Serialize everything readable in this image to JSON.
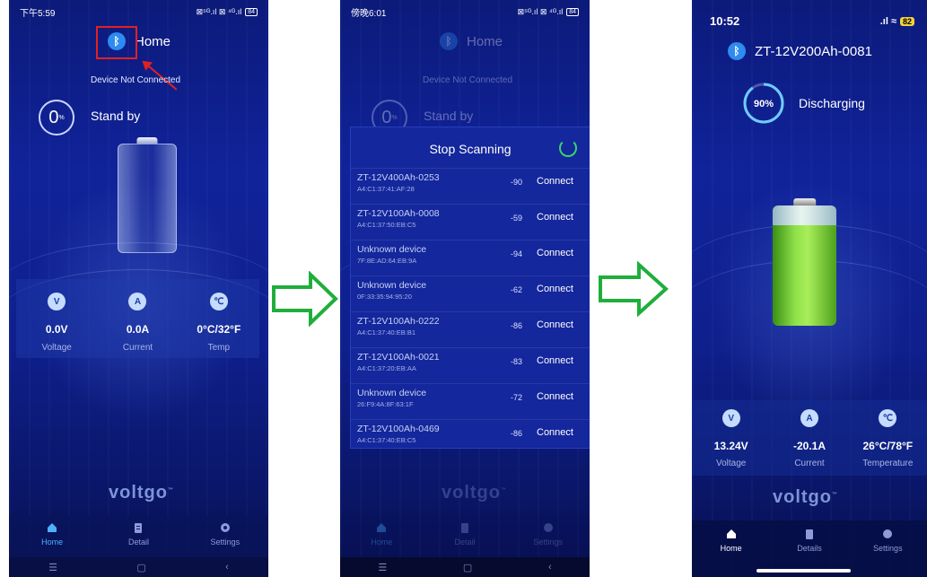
{
  "panel1": {
    "status_time": "下午5:59",
    "status_icons": "⊠⁵ᴳ.ıl ⊠ ⁴ᴳ.ıl",
    "battery_indicator": "84",
    "bluetooth_icon": "bluetooth-icon",
    "title": "Home",
    "connection_status": "Device Not Connected",
    "percent": "0",
    "percent_sign": "%",
    "state": "Stand by",
    "stats": [
      {
        "icon": "voltage-icon",
        "glyph": "V",
        "value": "0.0V",
        "label": "Voltage"
      },
      {
        "icon": "current-icon",
        "glyph": "A",
        "value": "0.0A",
        "label": "Current"
      },
      {
        "icon": "thermometer-icon",
        "glyph": "℃",
        "value": "0°C/32°F",
        "label": "Temp"
      }
    ],
    "logo": "voltgo",
    "logo_tm": "™",
    "tabs": [
      {
        "label": "Home",
        "icon": "home-icon",
        "active": true
      },
      {
        "label": "Detail",
        "icon": "clipboard-icon",
        "active": false
      },
      {
        "label": "Settings",
        "icon": "gear-icon",
        "active": false
      }
    ],
    "nav": [
      "☰",
      "▢",
      "‹"
    ]
  },
  "panel2": {
    "status_time": "傍晚6:01",
    "status_icons": "⊠⁵ᴳ.ıl ⊠ ⁴ᴳ.ıl",
    "battery_indicator": "84",
    "title": "Home",
    "connection_status": "Device Not Connected",
    "percent": "0",
    "percent_sign": "%",
    "state": "Stand by",
    "logo": "voltgo",
    "logo_tm": "™",
    "dialog": {
      "title": "Stop Scanning",
      "devices": [
        {
          "name": "ZT-12V400Ah-0253",
          "mac": "A4:C1:37:41:AF:28",
          "rssi": "-90",
          "action": "Connect"
        },
        {
          "name": "ZT-12V100Ah-0008",
          "mac": "A4:C1:37:50:EB:C5",
          "rssi": "-59",
          "action": "Connect"
        },
        {
          "name": "Unknown device",
          "mac": "7F:8E:AD:64:EB:9A",
          "rssi": "-94",
          "action": "Connect"
        },
        {
          "name": "Unknown device",
          "mac": "0F:33:35:94:95:20",
          "rssi": "-62",
          "action": "Connect"
        },
        {
          "name": "ZT-12V100Ah-0222",
          "mac": "A4:C1:37:40:EB:B1",
          "rssi": "-86",
          "action": "Connect"
        },
        {
          "name": "ZT-12V100Ah-0021",
          "mac": "A4:C1:37:20:EB:AA",
          "rssi": "-83",
          "action": "Connect"
        },
        {
          "name": "Unknown device",
          "mac": "26:F9:4A:8F:63:1F",
          "rssi": "-72",
          "action": "Connect"
        },
        {
          "name": "ZT-12V100Ah-0469",
          "mac": "A4:C1:37:40:EB:C5",
          "rssi": "-86",
          "action": "Connect"
        }
      ]
    },
    "tabs": [
      {
        "label": "Home",
        "icon": "home-icon",
        "active": true
      },
      {
        "label": "Detail",
        "icon": "clipboard-icon",
        "active": false
      },
      {
        "label": "Settings",
        "icon": "gear-icon",
        "active": false
      }
    ],
    "nav": [
      "☰",
      "▢",
      "‹"
    ]
  },
  "panel3": {
    "status_time": "10:52",
    "status_icons": ".ıl ≈",
    "battery_indicator": "82",
    "device_name": "ZT-12V200Ah-0081",
    "percent": "90%",
    "state": "Discharging",
    "charge_fraction": 0.9,
    "stats": [
      {
        "icon": "voltage-icon",
        "glyph": "V",
        "value": "13.24V",
        "label": "Voltage"
      },
      {
        "icon": "current-icon",
        "glyph": "A",
        "value": "-20.1A",
        "label": "Current"
      },
      {
        "icon": "thermometer-icon",
        "glyph": "℃",
        "value": "26°C/78°F",
        "label": "Temperature"
      }
    ],
    "logo": "voltgo",
    "logo_tm": "™",
    "tabs": [
      {
        "label": "Home",
        "icon": "home-icon",
        "active": true
      },
      {
        "label": "Details",
        "icon": "clipboard-icon",
        "active": false
      },
      {
        "label": "Settings",
        "icon": "gear-icon",
        "active": false
      }
    ]
  },
  "colors": {
    "accent_green": "#1fae3c",
    "highlight_red": "#e32020",
    "bluetooth_blue": "#2e8bf0"
  },
  "flow_arrows": [
    "right-arrow-icon",
    "right-arrow-icon"
  ]
}
